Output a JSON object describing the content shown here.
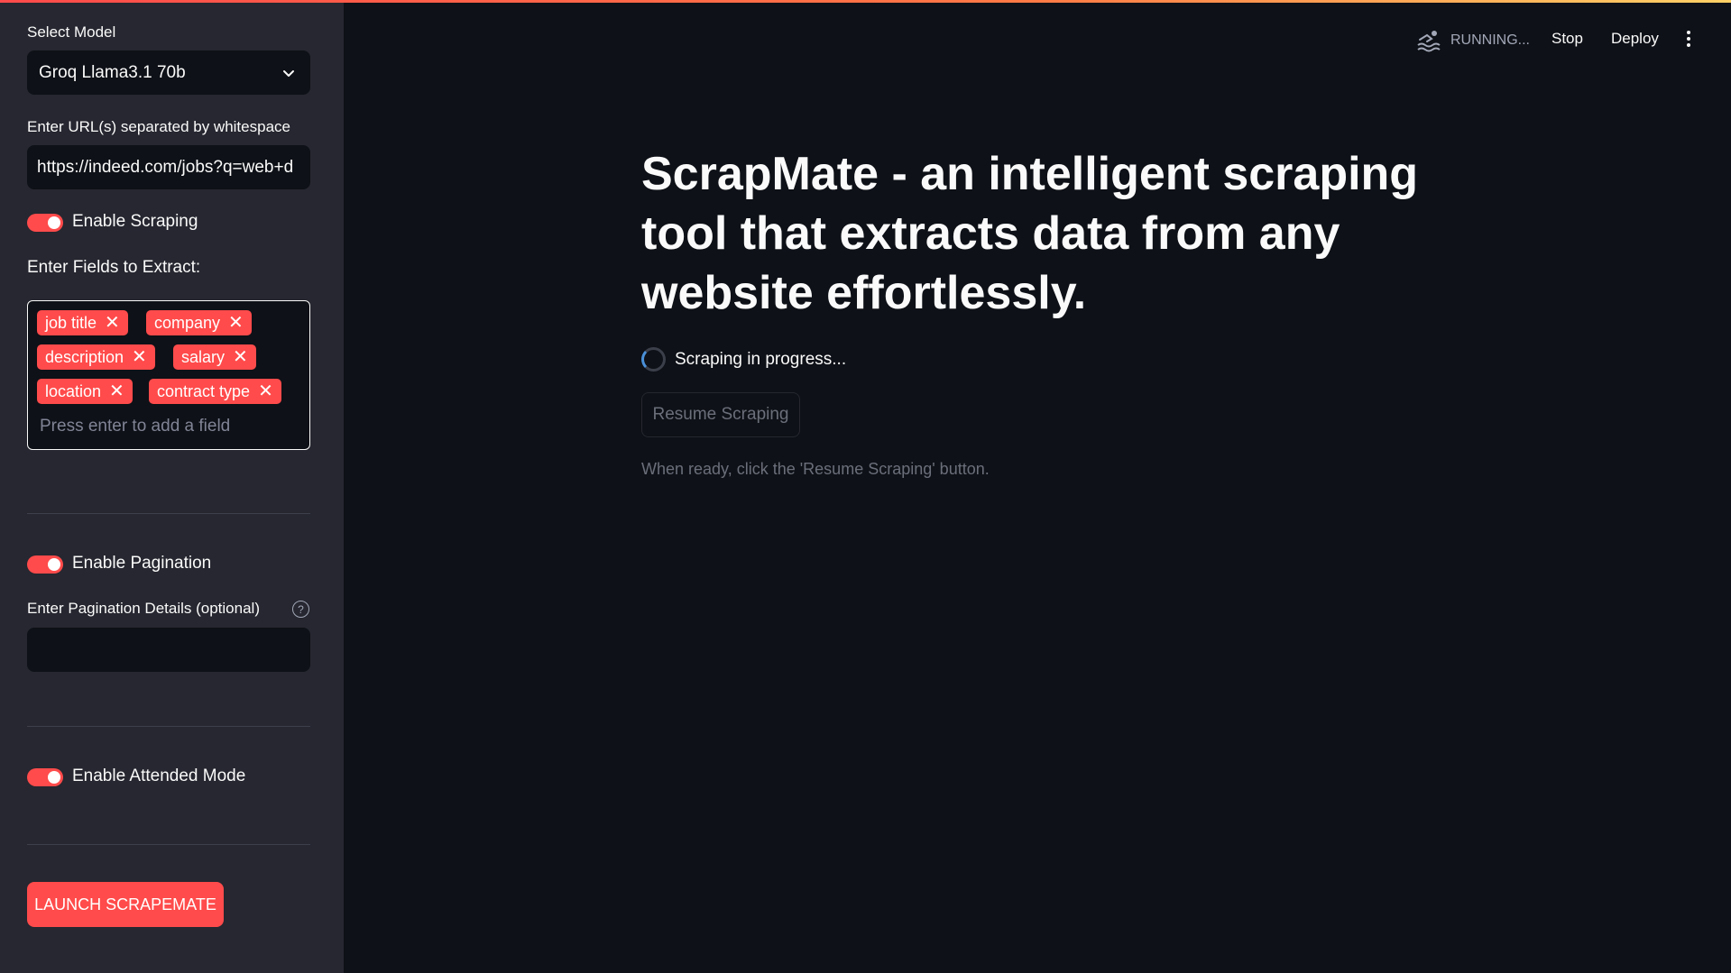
{
  "sidebar": {
    "select_model_label": "Select Model",
    "selected_model": "Groq Llama3.1 70b",
    "url_label": "Enter URL(s) separated by whitespace",
    "url_value": "https://indeed.com/jobs?q=web+d",
    "enable_scraping_label": "Enable Scraping",
    "enable_scraping": true,
    "fields_label": "Enter Fields to Extract:",
    "fields": [
      "job title",
      "company",
      "description",
      "salary",
      "location",
      "contract type"
    ],
    "fields_placeholder": "Press enter to add a field",
    "enable_pagination_label": "Enable Pagination",
    "enable_pagination": true,
    "pagination_label": "Enter Pagination Details (optional)",
    "pagination_value": "",
    "enable_attended_label": "Enable Attended Mode",
    "enable_attended": true,
    "launch_label": "LAUNCH SCRAPEMATE"
  },
  "header": {
    "status_text": "RUNNING...",
    "stop_label": "Stop",
    "deploy_label": "Deploy"
  },
  "main": {
    "title": "ScrapMate - an intelligent scraping tool that extracts data from any website effortlessly.",
    "progress_text": "Scraping in progress...",
    "resume_label": "Resume Scraping",
    "hint_text": "When ready, click the 'Resume Scraping' button."
  },
  "colors": {
    "accent": "#ff4b4b",
    "background": "#0e1117",
    "sidebar": "#262730"
  }
}
